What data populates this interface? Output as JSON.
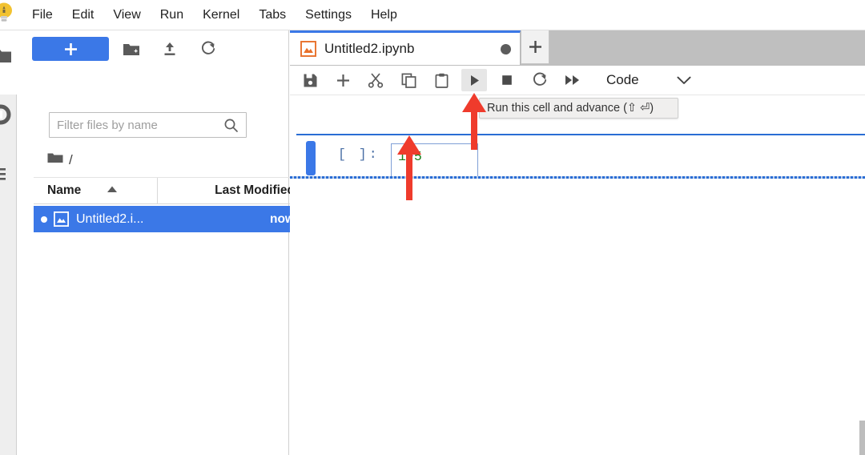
{
  "app": {
    "logo_icon": "jupyter-logo-icon"
  },
  "menubar": {
    "items": [
      {
        "label": "File"
      },
      {
        "label": "Edit"
      },
      {
        "label": "View"
      },
      {
        "label": "Run"
      },
      {
        "label": "Kernel"
      },
      {
        "label": "Tabs"
      },
      {
        "label": "Settings"
      },
      {
        "label": "Help"
      }
    ]
  },
  "rail": {
    "items": [
      {
        "icon": "folder-icon",
        "name": "file-browser"
      },
      {
        "icon": "running-terminals-icon",
        "name": "running-sessions"
      },
      {
        "icon": "commands-list-icon",
        "name": "commands"
      }
    ]
  },
  "filebrowser": {
    "toolbar": {
      "new_launcher_label": "+",
      "new_launcher_icon": "plus-icon",
      "new_folder_icon": "new-folder-icon",
      "upload_icon": "upload-icon",
      "refresh_icon": "refresh-icon"
    },
    "filter": {
      "placeholder": "Filter files by name",
      "value": "",
      "icon": "search-icon"
    },
    "breadcrumb": {
      "root_icon": "folder-icon",
      "path": "/"
    },
    "columns": {
      "name": "Name",
      "last_modified": "Last Modified",
      "sort_indicator": "▲"
    },
    "items": [
      {
        "name": "Untitled2.i...",
        "last_modified": "now",
        "icon": "notebook-icon",
        "status_icon": "unsaved-dot",
        "selected": true
      }
    ]
  },
  "notebook": {
    "tabs": [
      {
        "title": "Untitled2.ipynb",
        "icon": "notebook-icon",
        "dirty_indicator": "unsaved-circle",
        "active": true
      }
    ],
    "new_tab_label": "+",
    "new_tab_icon": "plus-icon",
    "toolbar": {
      "buttons": [
        {
          "name": "save",
          "icon": "save-icon",
          "active": false
        },
        {
          "name": "insert-cell",
          "icon": "plus-icon",
          "active": false
        },
        {
          "name": "cut-cell",
          "icon": "scissors-icon",
          "active": false
        },
        {
          "name": "copy-cell",
          "icon": "copy-icon",
          "active": false
        },
        {
          "name": "paste-cell",
          "icon": "paste-icon",
          "active": false
        },
        {
          "name": "run-cell",
          "icon": "play-icon",
          "active": true
        },
        {
          "name": "interrupt-kernel",
          "icon": "stop-square-icon",
          "active": false
        },
        {
          "name": "restart-kernel",
          "icon": "restart-icon",
          "active": false
        },
        {
          "name": "restart-and-run-all",
          "icon": "fast-forward-icon",
          "active": false
        }
      ],
      "cell_type": {
        "value": "Code",
        "chevron_icon": "chevron-down-icon"
      }
    },
    "cell": {
      "prompt": "[ ]:",
      "code": "1+5",
      "tokens": [
        {
          "text": "1",
          "type": "number"
        },
        {
          "text": "+",
          "type": "operator"
        },
        {
          "text": "5",
          "type": "number"
        }
      ],
      "selected": true
    }
  },
  "tooltip": {
    "text": "Run this cell and advance (⇧ ⏎)"
  },
  "annotations": {
    "arrows": [
      {
        "name": "arrow-to-code-cell",
        "direction": "up"
      },
      {
        "name": "arrow-to-run-button",
        "direction": "up"
      }
    ],
    "color": "#ef3b2c"
  },
  "colors": {
    "accent_blue": "#3b78e7",
    "tabbar_gray": "#bfbfbf",
    "annotation_red": "#ef3b2c",
    "code_number_green": "#197d19",
    "code_operator_purple": "#aa22ff"
  }
}
